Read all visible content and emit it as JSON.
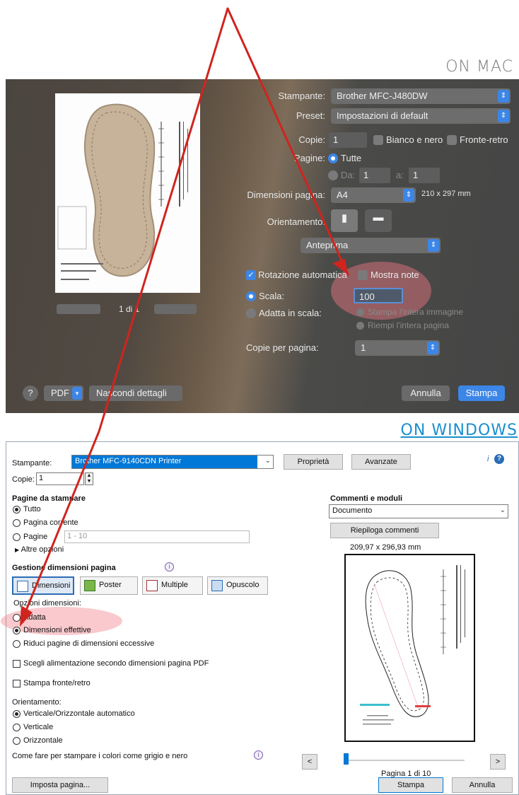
{
  "labels": {
    "mac": "ON MAC",
    "windows": "ON WINDOWS"
  },
  "mac": {
    "printer_label": "Stampante:",
    "printer_value": "Brother MFC-J480DW",
    "preset_label": "Preset:",
    "preset_value": "Impostazioni di default",
    "copies_label": "Copie:",
    "copies_value": "1",
    "bw_label": "Bianco e nero",
    "duplex_label": "Fronte-retro",
    "pages_label": "Pagine:",
    "pages_all": "Tutte",
    "pages_from": "Da:",
    "pages_from_value": "1",
    "pages_to": "a:",
    "pages_to_value": "1",
    "paper_size_label": "Dimensioni pagina:",
    "paper_size_value": "A4",
    "paper_size_dims": "210 x 297 mm",
    "orientation_label": "Orientamento:",
    "section_value": "Anteprima",
    "auto_rotate": "Rotazione automatica",
    "show_notes": "Mostra note",
    "scale_label": "Scala:",
    "scale_value": "100",
    "fit_label": "Adatta in scala:",
    "fit_opt1": "Stampa l'intera immagine",
    "fit_opt2": "Riempi l'intera pagina",
    "pages_per_sheet_label": "Copie per pagina:",
    "pages_per_sheet_value": "1",
    "page_count": "1 di 1",
    "help": "?",
    "pdf": "PDF",
    "hide_details": "Nascondi dettagli",
    "cancel": "Annulla",
    "print": "Stampa"
  },
  "windows": {
    "printer_label": "Stampante:",
    "printer_value": "Brother MFC-9140CDN Printer",
    "properties": "Proprietà",
    "advanced": "Avanzate",
    "copies_label": "Copie:",
    "copies_value": "1",
    "pages_heading": "Pagine da stampare",
    "opt_all": "Tutto",
    "opt_current": "Pagina corrente",
    "opt_pages": "Pagine",
    "pages_placeholder": "1 - 10",
    "more_options": "Altre opzioni",
    "sizing_heading": "Gestione dimensioni pagina",
    "tab_size": "Dimensioni",
    "tab_poster": "Poster",
    "tab_multiple": "Multiple",
    "tab_booklet": "Opuscolo",
    "size_options": "Opzioni dimensioni:",
    "opt_fit": "Adatta",
    "opt_actual": "Dimensioni effettive",
    "opt_shrink": "Riduci pagine di dimensioni eccessive",
    "choose_source": "Scegli alimentazione secondo dimensioni pagina PDF",
    "duplex": "Stampa fronte/retro",
    "orientation_heading": "Orientamento:",
    "orient_auto": "Verticale/Orizzontale automatico",
    "orient_portrait": "Verticale",
    "orient_landscape": "Orizzontale",
    "gray_help": "Come fare per stampare i colori come grigio e nero",
    "page_setup": "Imposta pagina...",
    "comments_heading": "Commenti e moduli",
    "comments_value": "Documento",
    "summarize": "Riepiloga commenti",
    "dims": "209,97 x 296,93 mm",
    "page_of": "Pagina 1 di 10",
    "print": "Stampa",
    "cancel": "Annulla",
    "nav_prev": "<",
    "nav_next": ">",
    "help_icon": "?",
    "info_icon": "i"
  },
  "colors": {
    "accent_mac": "#3c86e8",
    "accent_win": "#0078d7",
    "annotation": "#d0241e",
    "highlight": "#f07882"
  }
}
